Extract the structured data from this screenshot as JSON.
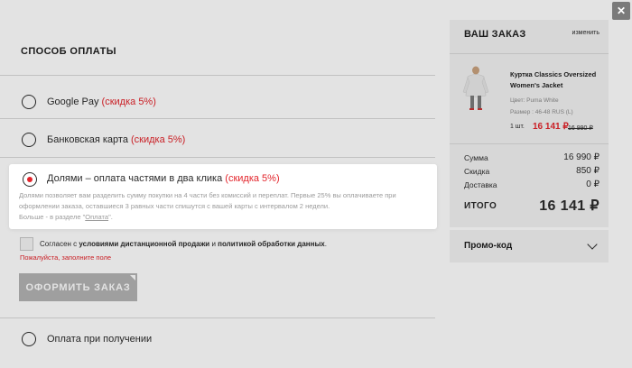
{
  "payment": {
    "title": "СПОСОБ ОПЛАТЫ",
    "options": [
      {
        "label": "Google Pay",
        "discount": "(скидка 5%)"
      },
      {
        "label": "Банковская карта",
        "discount": "(скидка 5%)"
      },
      {
        "label": "Долями – оплата частями в два клика",
        "discount": "(скидка 5%)"
      },
      {
        "label": "Оплата при получении",
        "discount": ""
      }
    ],
    "selected_desc_line1": "Долями позволяет вам разделить сумму покупки на 4 части без комиссий и переплат. Первые 25% вы оплачиваете при",
    "selected_desc_line2": "оформлении заказа, оставшиеся 3 равных части спишутся с вашей карты с интервалом 2 недели.",
    "more_prefix": "Больше - в разделе \"",
    "more_link": "Оплата",
    "more_suffix": "\"."
  },
  "consent": {
    "prefix": "Согласен с ",
    "terms_link": "условиями дистанционной продажи",
    "and": " и ",
    "policy_link": "политикой обработки данных",
    "suffix": ".",
    "error": "Пожалуйста, заполните поле"
  },
  "order_button": "ОФОРМИТЬ ЗАКАЗ",
  "order": {
    "title": "ВАШ ЗАКАЗ",
    "edit": "изменить",
    "product": {
      "name": "Куртка Classics Oversized Women's Jacket",
      "color": "Цвет: Puma White",
      "size": "Размер : 46-48 RUS (L)",
      "qty": "1 шт.",
      "price": "16 141 ₽",
      "old_price": "16 990 ₽"
    },
    "summary": [
      {
        "label": "Сумма",
        "value": "16 990 ₽"
      },
      {
        "label": "Скидка",
        "value": "850 ₽"
      },
      {
        "label": "Доставка",
        "value": "0 ₽"
      }
    ],
    "total_label": "ИТОГО",
    "total_value": "16 141 ₽"
  },
  "promo": {
    "label": "Промо-код"
  },
  "close": "✕",
  "colors": {
    "accent": "#e3242b",
    "panel": "#f2f2f2",
    "button_disabled": "#b3b3b3"
  }
}
